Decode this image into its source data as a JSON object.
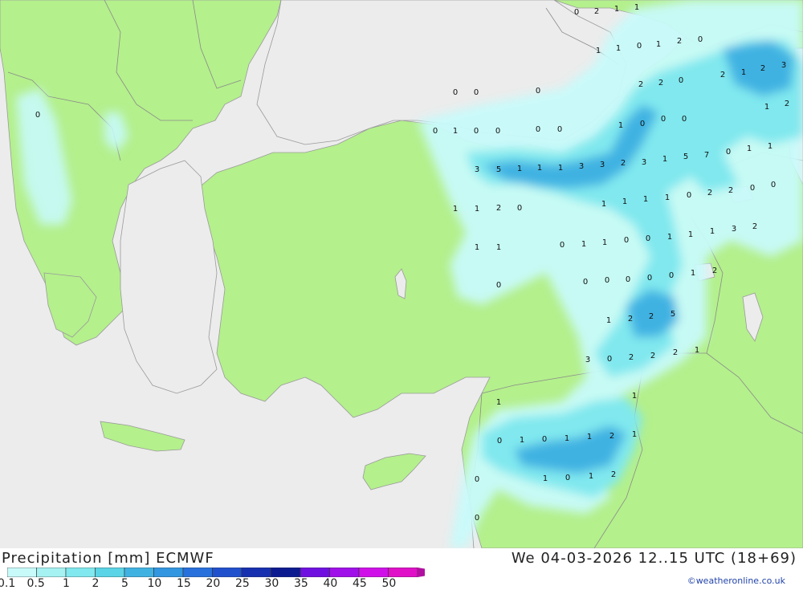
{
  "title": "Precipitation [mm] ECMWF",
  "valid_time": "We 04-03-2026 12..15 UTC (18+69)",
  "credit": "©weatheronline.co.uk",
  "legend": {
    "labels": [
      "0.1",
      "0.5",
      "1",
      "2",
      "5",
      "10",
      "15",
      "20",
      "25",
      "30",
      "35",
      "40",
      "45",
      "50"
    ],
    "colors": [
      "#c8fafa",
      "#a6f2f2",
      "#80e8ee",
      "#5ad4e6",
      "#40b2e2",
      "#3296e0",
      "#2870dc",
      "#2050cc",
      "#1630b0",
      "#0c1a90",
      "#7010e0",
      "#a010e8",
      "#d010e8",
      "#e010c8",
      "#b010a0"
    ]
  },
  "colors": {
    "sea": "#ececec",
    "land": "#b4f08c",
    "precip_light": "#c8fafa",
    "precip_mid": "#80e8ee",
    "precip_heavy": "#40b2e2"
  },
  "map_labels": [
    "0",
    "2",
    "1",
    "1",
    "1",
    "1",
    "0",
    "1",
    "2",
    "0",
    "1",
    "2",
    "3",
    "2",
    "2",
    "2",
    "0",
    "0",
    "0",
    "0",
    "1",
    "2",
    "0",
    "1",
    "0",
    "0",
    "0",
    "0",
    "1",
    "0",
    "0",
    "0",
    "3",
    "5",
    "1",
    "1",
    "1",
    "3",
    "3",
    "2",
    "3",
    "1",
    "5",
    "7",
    "0",
    "1",
    "1",
    "2",
    "2",
    "0",
    "0",
    "1",
    "1",
    "2",
    "0",
    "1",
    "1",
    "1",
    "1",
    "0",
    "1",
    "1",
    "0",
    "1",
    "1",
    "0",
    "0",
    "1",
    "1",
    "1",
    "3",
    "2",
    "0",
    "0",
    "0",
    "0",
    "0",
    "0",
    "1",
    "2",
    "1",
    "2",
    "2",
    "5",
    "3",
    "0",
    "2",
    "2",
    "2",
    "1",
    "1",
    "1",
    "0",
    "1",
    "0",
    "1",
    "1",
    "2",
    "1",
    "1",
    "0",
    "1",
    "2",
    "0",
    "0",
    "0"
  ]
}
